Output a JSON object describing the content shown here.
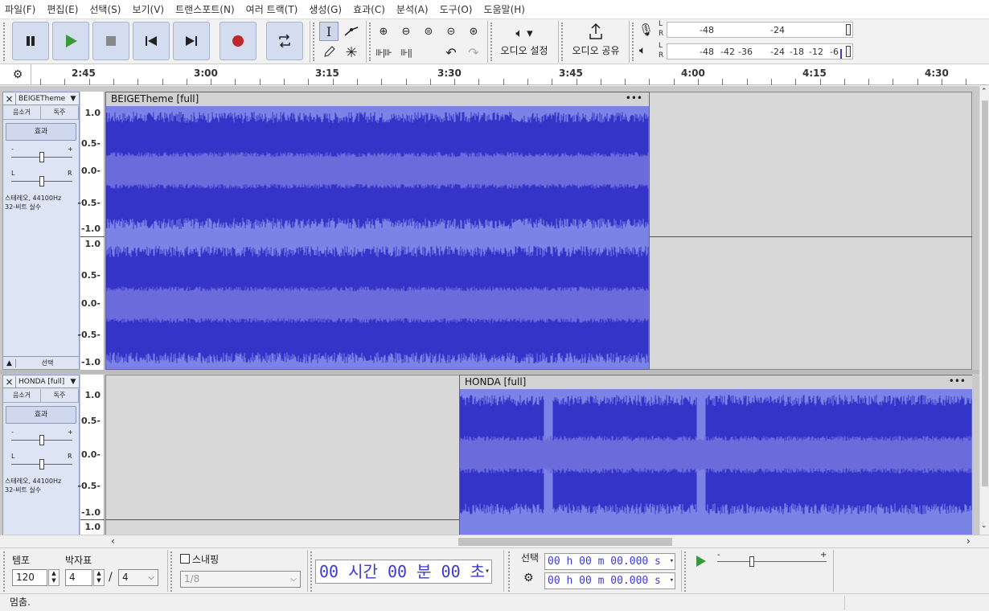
{
  "menu": [
    "파일(F)",
    "편집(E)",
    "선택(S)",
    "보기(V)",
    "트랜스포트(N)",
    "여러 트랙(T)",
    "생성(G)",
    "효과(C)",
    "분석(A)",
    "도구(O)",
    "도움말(H)"
  ],
  "toolbar": {
    "audio_setup_label": "오디오 설정",
    "share_audio_label": "오디오 공유",
    "rec_meter_ticks": [
      "-48",
      "-24"
    ],
    "play_meter_ticks": [
      "-48",
      "-42",
      "-36",
      "-24",
      "-18",
      "-12",
      "-6"
    ],
    "lr_l": "L",
    "lr_r": "R"
  },
  "ruler": {
    "ticks": [
      "2:45",
      "3:00",
      "3:15",
      "3:30",
      "3:45",
      "4:00",
      "4:15",
      "4:30"
    ]
  },
  "track1": {
    "name": "BEIGETheme [",
    "mute": "음소거",
    "solo": "독주",
    "effects": "효과",
    "pan_l": "L",
    "pan_r": "R",
    "gain_minus": "-",
    "gain_plus": "+",
    "info_line1": "스테레오, 44100Hz",
    "info_line2": "32-비트 실수",
    "select": "선택",
    "clip_title": "BEIGETheme [full]",
    "scale": [
      "1.0",
      "0.5-",
      "0.0-",
      "-0.5-",
      "-1.0"
    ]
  },
  "track2": {
    "name": "HONDA [full]",
    "mute": "음소거",
    "solo": "독주",
    "effects": "효과",
    "pan_l": "L",
    "pan_r": "R",
    "gain_minus": "-",
    "gain_plus": "+",
    "info_line1": "스테레오, 44100Hz",
    "info_line2": "32-비트 실수",
    "clip_title": "HONDA [full]",
    "scale": [
      "1.0",
      "0.5-",
      "0.0-",
      "-0.5-",
      "-1.0"
    ],
    "scale2_top": "1.0"
  },
  "bottom": {
    "tempo_label": "템포",
    "tempo_value": "120",
    "timesig_label": "박자표",
    "timesig_num": "4",
    "timesig_slash": "/",
    "timesig_den": "4",
    "snap_label": "스내핑",
    "snap_value": "1/8",
    "time_display": "00 시간 00 분 00 초",
    "selection_label": "선택",
    "sel_start": "00 h 00 m 00.000 s",
    "sel_end": "00 h 00 m 00.000 s",
    "speed_minus": "-",
    "speed_plus": "+"
  },
  "status": "멈춤.",
  "colors": {
    "wave_dark": "#3434c8",
    "wave_light": "#6b6bdc",
    "accent": "#3a3ad0",
    "record": "#c0262a",
    "play": "#3a9a3a"
  }
}
